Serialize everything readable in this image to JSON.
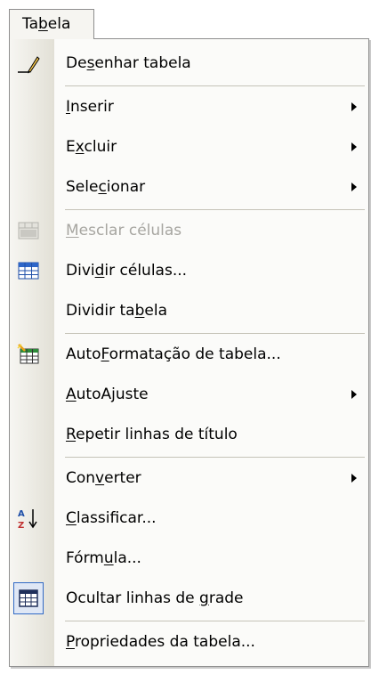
{
  "menu_title": {
    "pre": "Ta",
    "key": "b",
    "post": "ela"
  },
  "items": [
    {
      "pre": "De",
      "key": "s",
      "post": "enhar tabela",
      "icon": "pencil-icon"
    },
    {
      "pre": "",
      "key": "I",
      "post": "nserir",
      "submenu": true
    },
    {
      "pre": "E",
      "key": "x",
      "post": "cluir",
      "submenu": true
    },
    {
      "pre": "Sele",
      "key": "c",
      "post": "ionar",
      "submenu": true
    },
    {
      "pre": "",
      "key": "M",
      "post": "esclar células",
      "icon": "merge-cells-icon",
      "disabled": true
    },
    {
      "pre": "Divi",
      "key": "d",
      "post": "ir células...",
      "icon": "split-cells-icon"
    },
    {
      "pre": "Dividir ta",
      "key": "b",
      "post": "ela"
    },
    {
      "pre": "Auto",
      "key": "F",
      "post": "ormatação de tabela...",
      "icon": "table-autoformat-icon"
    },
    {
      "pre": "",
      "key": "A",
      "post": "utoAjuste",
      "submenu": true
    },
    {
      "pre": "",
      "key": "R",
      "post": "epetir linhas de título"
    },
    {
      "pre": "Con",
      "key": "v",
      "post": "erter",
      "submenu": true
    },
    {
      "pre": "",
      "key": "C",
      "post": "lassificar...",
      "icon": "sort-az-icon"
    },
    {
      "pre": "Fórm",
      "key": "u",
      "post": "la..."
    },
    {
      "pre": "Ocultar linhas de ",
      "key": "g",
      "post": "rade",
      "icon": "gridlines-icon",
      "checked": true
    },
    {
      "pre": "",
      "key": "P",
      "post": "ropriedades da tabela..."
    }
  ],
  "colors": {
    "menu_bg": "#fbfbf9",
    "disabled_text": "#a7a6a1",
    "highlight_border": "#316ac5"
  }
}
